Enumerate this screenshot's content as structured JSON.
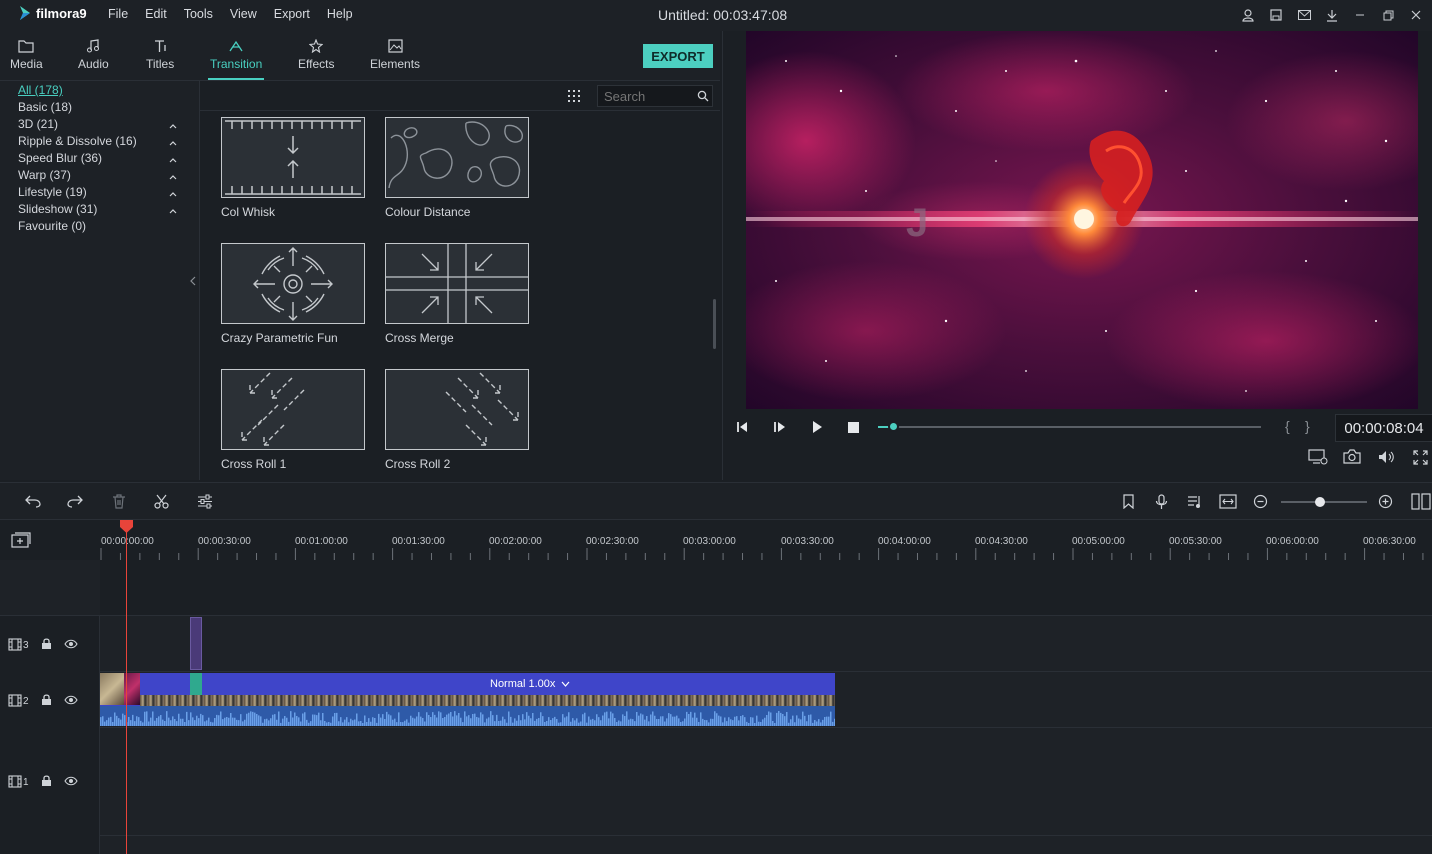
{
  "app": {
    "name": "filmora9",
    "doc_title": "Untitled:",
    "doc_time": "00:03:47:08"
  },
  "menu": [
    "File",
    "Edit",
    "Tools",
    "View",
    "Export",
    "Help"
  ],
  "tabs": [
    {
      "label": "Media",
      "icon": "folder-icon"
    },
    {
      "label": "Audio",
      "icon": "music-note-icon"
    },
    {
      "label": "Titles",
      "icon": "text-icon"
    },
    {
      "label": "Transition",
      "icon": "transition-icon",
      "active": true
    },
    {
      "label": "Effects",
      "icon": "effects-icon"
    },
    {
      "label": "Elements",
      "icon": "image-icon"
    }
  ],
  "export_label": "EXPORT",
  "categories": [
    {
      "label": "All (178)",
      "active": true
    },
    {
      "label": "Basic (18)"
    },
    {
      "label": "3D (21)",
      "caret": true
    },
    {
      "label": "Ripple & Dissolve (16)",
      "caret": true
    },
    {
      "label": "Speed Blur (36)",
      "caret": true
    },
    {
      "label": "Warp (37)",
      "caret": true
    },
    {
      "label": "Lifestyle (19)",
      "caret": true
    },
    {
      "label": "Slideshow (31)",
      "caret": true
    },
    {
      "label": "Favourite (0)"
    }
  ],
  "search": {
    "placeholder": "Search"
  },
  "transitions": [
    "Col Whisk",
    "Colour Distance",
    "Crazy Parametric Fun",
    "Cross Merge",
    "Cross Roll 1",
    "Cross Roll 2"
  ],
  "player": {
    "timecode": "00:00:08:04",
    "progress": 0.04
  },
  "timeline": {
    "ticks": [
      "00:00:00:00",
      "00:00:30:00",
      "00:01:00:00",
      "00:01:30:00",
      "00:02:00:00",
      "00:02:30:00",
      "00:03:00:00",
      "00:03:30:00",
      "00:04:00:00",
      "00:04:30:00",
      "00:05:00:00",
      "00:05:30:00",
      "00:06:00:00",
      "00:06:30:00"
    ],
    "tracks": [
      "3",
      "2",
      "1"
    ],
    "clip_label": "Normal 1.00x",
    "zoom": 0.45
  },
  "colors": {
    "accent": "#4ccfc0",
    "clip": "#3f45c9",
    "playhead": "#e8443a"
  }
}
